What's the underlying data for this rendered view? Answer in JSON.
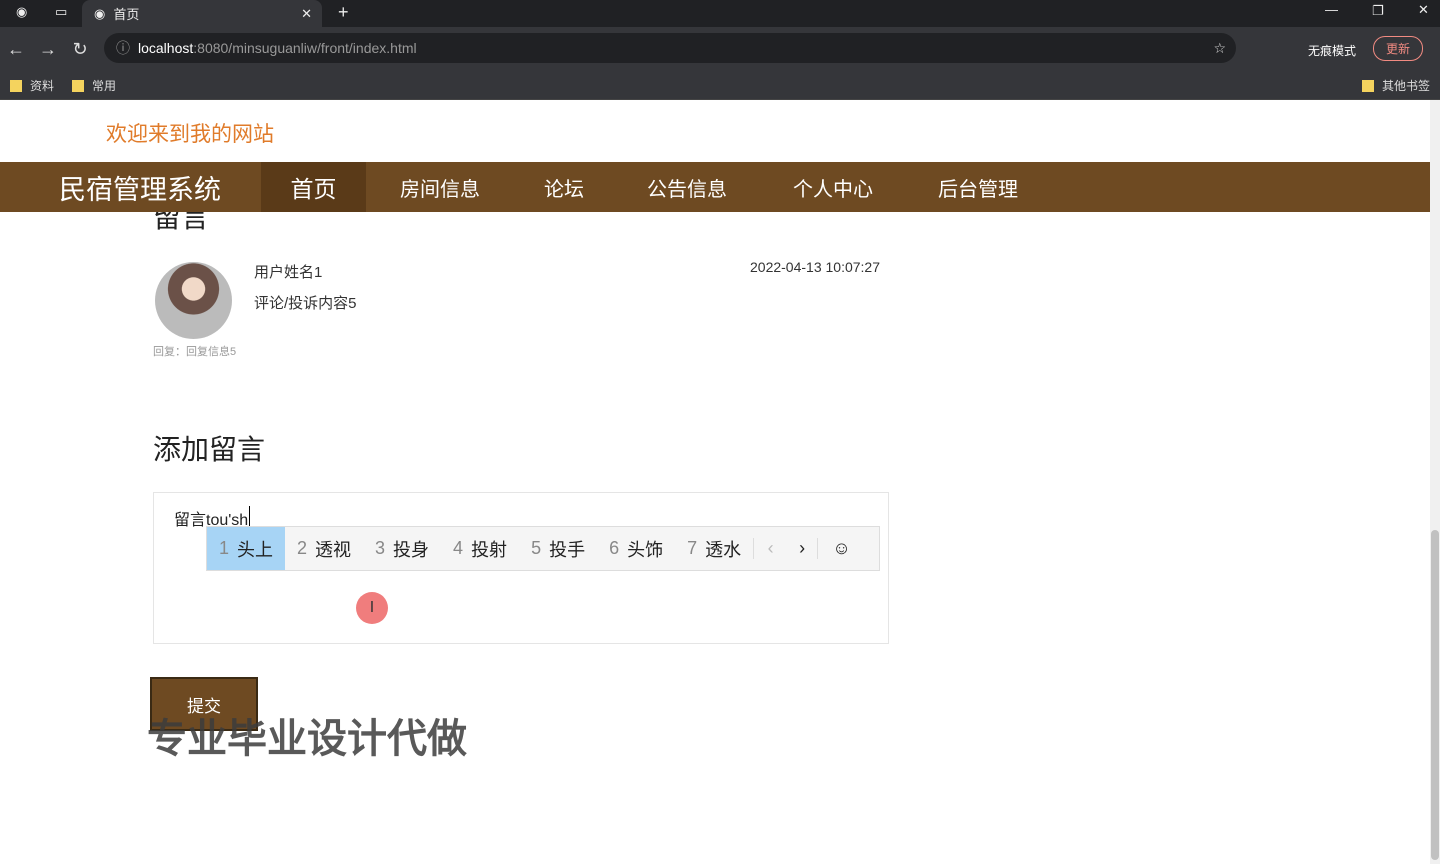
{
  "browser": {
    "tab_title": "首页",
    "url_host": "localhost",
    "url_path": ":8080/minsuguanliw/front/index.html",
    "bookmarks": [
      "资料",
      "常用"
    ],
    "other_bookmarks": "其他书签",
    "incognito": "无痕模式",
    "update": "更新"
  },
  "site": {
    "welcome": "欢迎来到我的网站",
    "brand": "民宿管理系统",
    "nav": [
      "首页",
      "房间信息",
      "论坛",
      "公告信息",
      "个人中心",
      "后台管理"
    ]
  },
  "comments": {
    "heading": "留言",
    "items": [
      {
        "user": "用户姓名1",
        "content": "评论/投诉内容5",
        "time": "2022-04-13 10:07:27",
        "reply": "回复：回复信息5"
      }
    ]
  },
  "add": {
    "heading": "添加留言",
    "input_value": "留言tou'sh",
    "submit": "提交"
  },
  "ime": {
    "candidates": [
      {
        "n": "1",
        "w": "头上"
      },
      {
        "n": "2",
        "w": "透视"
      },
      {
        "n": "3",
        "w": "投身"
      },
      {
        "n": "4",
        "w": "投射"
      },
      {
        "n": "5",
        "w": "投手"
      },
      {
        "n": "6",
        "w": "头饰"
      },
      {
        "n": "7",
        "w": "透水"
      }
    ]
  },
  "watermark": "专业毕业设计代做"
}
